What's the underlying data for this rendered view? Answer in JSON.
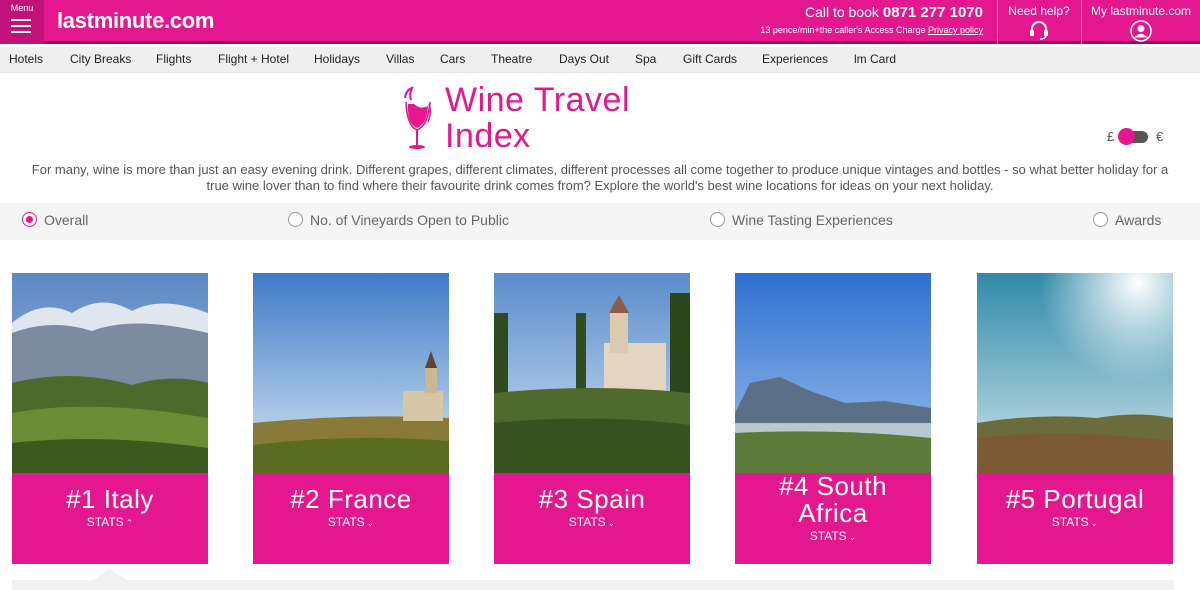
{
  "header": {
    "menu_label": "Menu",
    "logo": "lastminute.com",
    "call_label": "Call to book",
    "phone": "0871 277 1070",
    "charge_note": "13 pence/min+the caller's Access Charge",
    "privacy_link": "Privacy policy",
    "help_label": "Need help?",
    "account_label": "My lastminute.com"
  },
  "nav": [
    "Hotels",
    "City Breaks",
    "Flights",
    "Flight + Hotel",
    "Holidays",
    "Villas",
    "Cars",
    "Theatre",
    "Days Out",
    "Spa",
    "Gift Cards",
    "Experiences",
    "lm Card"
  ],
  "page": {
    "title_line1": "Wine Travel",
    "title_line2": "Index",
    "currency_left": "£",
    "currency_right": "€",
    "intro": "For many, wine is more than just an easy evening drink. Different grapes, different climates, different processes all come together to produce unique vintages and bottles - so what better holiday for a true wine lover than to find where their favourite drink comes from? Explore the world's best wine locations for ideas on your next holiday."
  },
  "filters": [
    {
      "label": "Overall",
      "selected": true
    },
    {
      "label": "No. of Vineyards Open to Public",
      "selected": false
    },
    {
      "label": "Wine Tasting Experiences",
      "selected": false
    },
    {
      "label": "Awards",
      "selected": false
    }
  ],
  "cards": [
    {
      "line1": "#1 Italy",
      "line2": "",
      "stats": "STATS",
      "chevron": "^"
    },
    {
      "line1": "#2 France",
      "line2": "",
      "stats": "STATS",
      "chevron": "v"
    },
    {
      "line1": "#3 Spain",
      "line2": "",
      "stats": "STATS",
      "chevron": "v"
    },
    {
      "line1": "#4 South",
      "line2": "Africa",
      "stats": "STATS",
      "chevron": "v"
    },
    {
      "line1": "#5 Portugal",
      "line2": "",
      "stats": "STATS",
      "chevron": "v"
    }
  ],
  "colors": {
    "brand": "#e5178f",
    "brand_dark": "#c3117a"
  },
  "icons": [
    "menu-icon",
    "headset-icon",
    "user-icon",
    "wine-glass-icon",
    "chevron-up-icon",
    "chevron-down-icon"
  ]
}
